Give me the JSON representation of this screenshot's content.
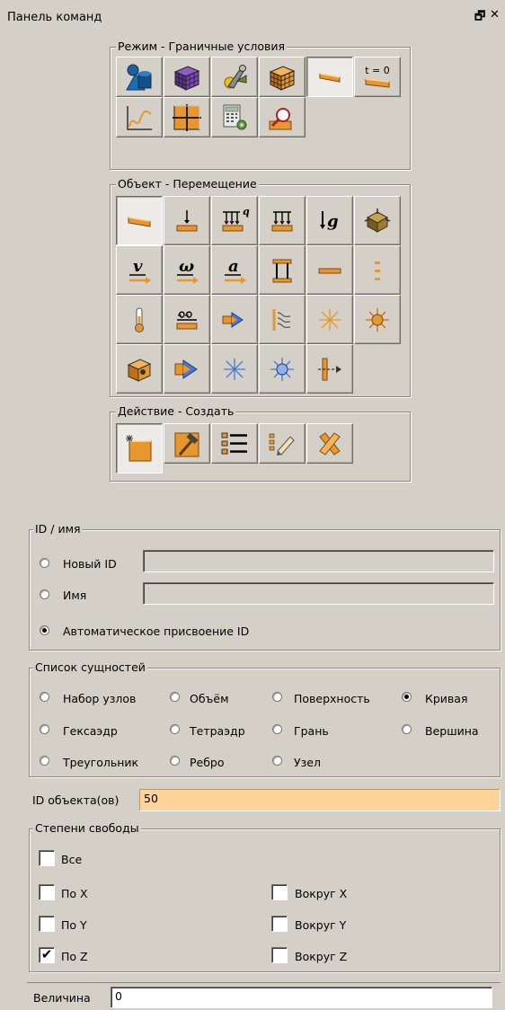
{
  "panel": {
    "title": "Панель команд",
    "pin_glyph": "🗗",
    "close_glyph": "✕"
  },
  "mode_group": {
    "legend": "Режим - Граничные условия",
    "buttons": [
      {
        "icon": "geometry-shapes-icon"
      },
      {
        "icon": "mesh-cube-icon"
      },
      {
        "icon": "tools-wrench-icon"
      },
      {
        "icon": "orange-cube-icon"
      },
      {
        "icon": "boundary-conditions-icon",
        "active": true
      },
      {
        "icon": "initial-conditions-icon",
        "label": "t = 0"
      },
      {
        "icon": "plot-graph-icon"
      },
      {
        "icon": "orange-grid-icon"
      },
      {
        "icon": "calculator-icon"
      },
      {
        "icon": "magnifier-icon"
      }
    ]
  },
  "object_group": {
    "legend": "Объект - Перемещение",
    "labels": {
      "q": "q",
      "g": "g",
      "v": "v",
      "omega": "ω",
      "a": "a"
    }
  },
  "action_group": {
    "legend": "Действие - Создать"
  },
  "id_name": {
    "legend": "ID / имя",
    "new_id_label": "Новый ID",
    "name_label": "Имя",
    "auto_label": "Автоматическое присвоение ID",
    "selected": "auto"
  },
  "entity_list": {
    "legend": "Список сущностей",
    "options": [
      "Набор узлов",
      "Объём",
      "Поверхность",
      "Кривая",
      "Гексаэдр",
      "Тетраэдр",
      "Грань",
      "Вершина",
      "Треугольник",
      "Ребро",
      "Узел"
    ],
    "selected": "Кривая"
  },
  "object_ids": {
    "label": "ID объекта(ов)",
    "value": "50"
  },
  "dof": {
    "legend": "Степени свободы",
    "all": "Все",
    "x": "По X",
    "y": "По Y",
    "z": "По Z",
    "rx": "Вокруг X",
    "ry": "Вокруг Y",
    "rz": "Вокруг Z",
    "checked_mark": "✔"
  },
  "magnitude": {
    "label": "Величина",
    "value": "0"
  },
  "colors": {
    "panel_bg": "#d4d0c8",
    "accent_orange": "#e8962e",
    "field_orange": "#ffd49a"
  }
}
